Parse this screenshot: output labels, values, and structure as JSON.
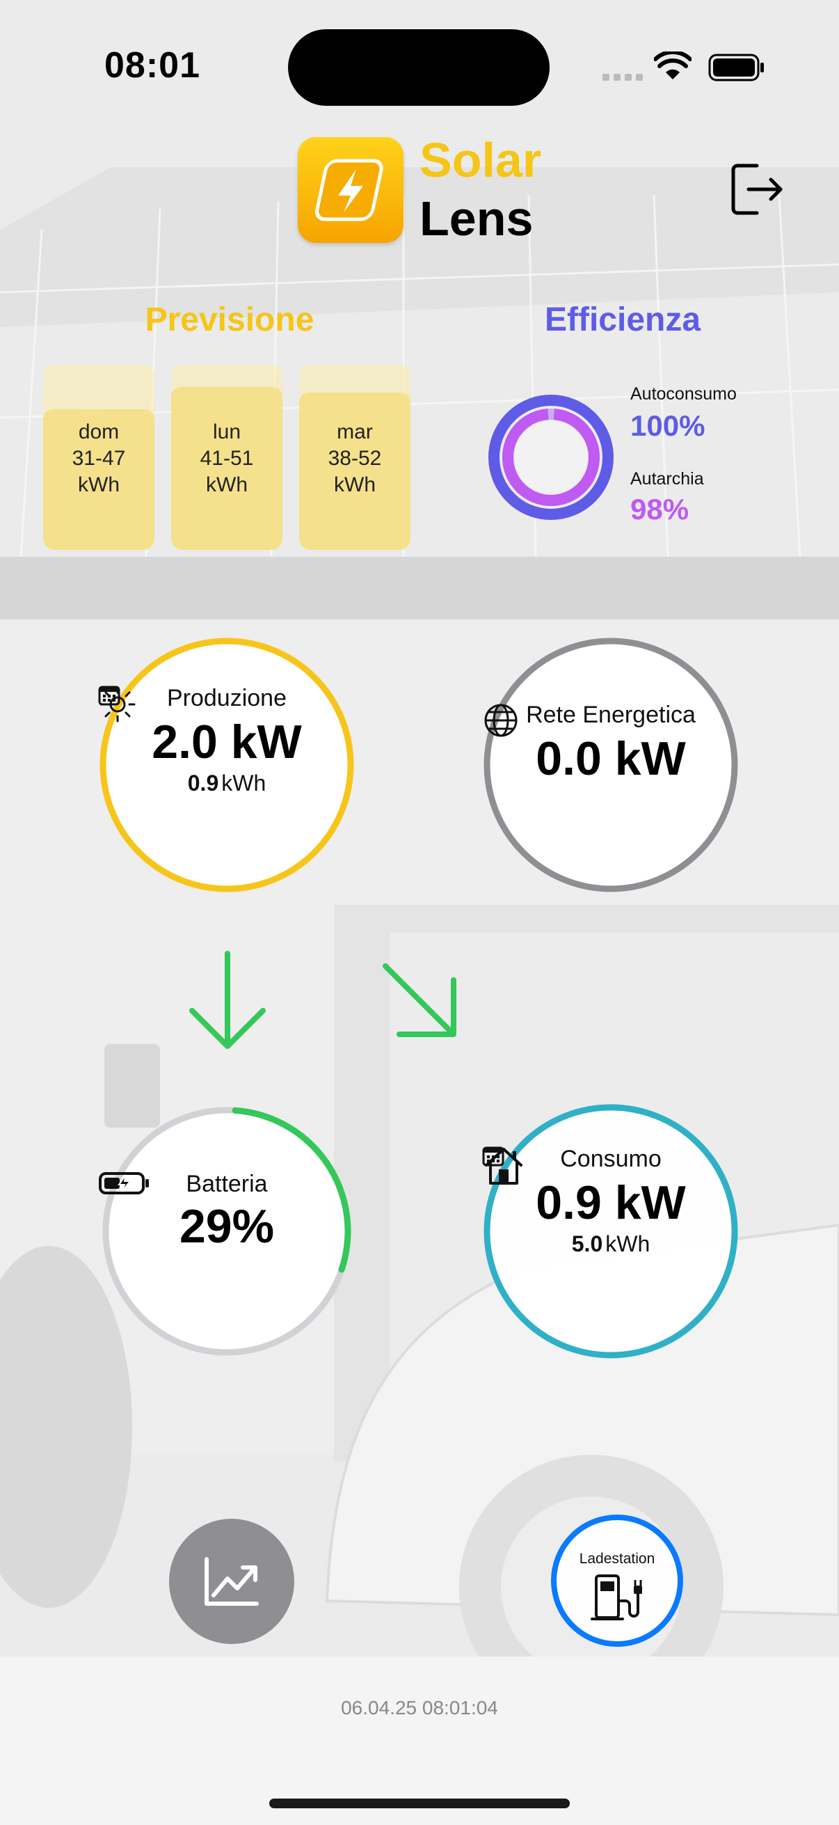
{
  "status_bar": {
    "time": "08:01"
  },
  "header": {
    "title_part1": "Solar",
    "title_part2": "Lens"
  },
  "forecast": {
    "title": "Previsione",
    "days": [
      {
        "day": "dom",
        "range": "31-47",
        "unit": "kWh",
        "level": 0.76
      },
      {
        "day": "lun",
        "range": "41-51",
        "unit": "kWh",
        "level": 0.88
      },
      {
        "day": "mar",
        "range": "38-52",
        "unit": "kWh",
        "level": 0.85
      }
    ]
  },
  "efficiency": {
    "title": "Efficienza",
    "self_consumption_label": "Autoconsumo",
    "self_consumption_value": "100%",
    "autarky_label": "Autarchia",
    "autarky_value": "98%"
  },
  "production": {
    "title": "Produzione",
    "power": "2.0 kW",
    "energy_value": "0.9",
    "energy_unit": "kWh"
  },
  "grid": {
    "title": "Rete Energetica",
    "power": "0.0 kW"
  },
  "battery": {
    "title": "Batteria",
    "level": "29%",
    "level_fraction": 0.29
  },
  "consumption": {
    "title": "Consumo",
    "power": "0.9 kW",
    "energy_value": "5.0",
    "energy_unit": "kWh"
  },
  "charging_station": {
    "label": "Ladestation"
  },
  "footer": {
    "timestamp": "06.04.25 08:01:04"
  },
  "colors": {
    "production_ring": "#f7c51a",
    "grid_ring": "#8e8e93",
    "battery_ring": "#34c759",
    "consumption_ring": "#30b0c7",
    "flow_arrow": "#34c759",
    "efficiency_outer": "#5e5ce6",
    "efficiency_inner": "#bf5af2",
    "charging_ring": "#0a7aff"
  }
}
